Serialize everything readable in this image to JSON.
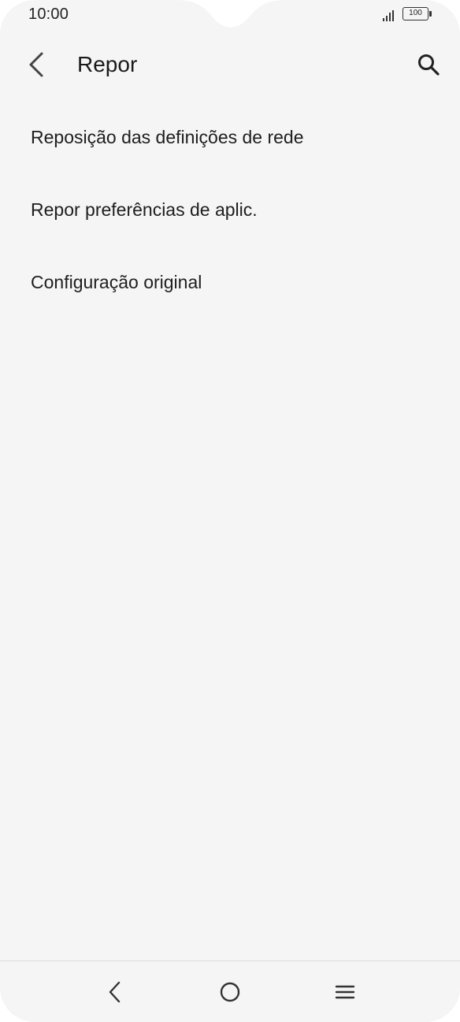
{
  "status_bar": {
    "time": "10:00",
    "battery_level": "100",
    "signal_icon": "signal-bars-icon"
  },
  "app_bar": {
    "title": "Repor",
    "back_icon": "chevron-left-icon",
    "search_icon": "search-icon"
  },
  "list": {
    "items": [
      {
        "label": "Reposição das definições de rede"
      },
      {
        "label": "Repor preferências de aplic."
      },
      {
        "label": "Configuração original"
      }
    ]
  },
  "nav_bar": {
    "back_icon": "nav-back-icon",
    "home_icon": "nav-home-icon",
    "menu_icon": "nav-menu-icon"
  },
  "colors": {
    "background": "#f5f5f5",
    "text": "#1e1e1e",
    "icon": "#333333"
  }
}
